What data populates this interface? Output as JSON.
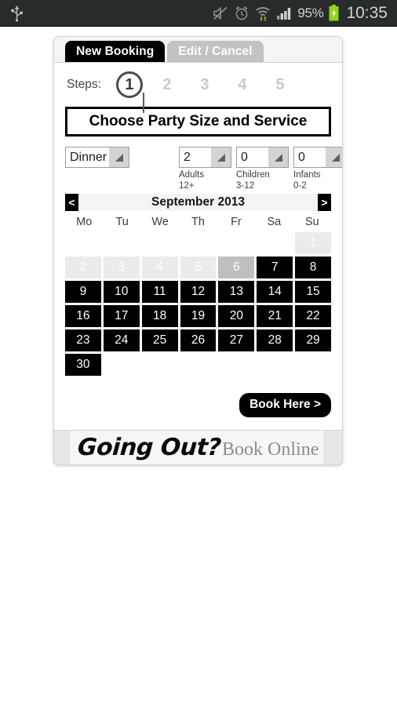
{
  "status_bar": {
    "usb_icon": "usb-icon",
    "icons": [
      "mute-icon",
      "alarm-icon",
      "wifi-icon",
      "signal-icon"
    ],
    "battery_percent": "95%",
    "battery_icon": "battery-charging-icon",
    "clock": "10:35",
    "background_color": "#272b2b",
    "text_color": "#cfd2d2",
    "battery_color": "#8fd315"
  },
  "tabs": [
    {
      "label": "New Booking",
      "active": true
    },
    {
      "label": "Edit / Cancel",
      "active": false
    }
  ],
  "steps": {
    "label": "Steps:",
    "items": [
      "1",
      "2",
      "3",
      "4",
      "5"
    ],
    "current": "1"
  },
  "section_title": "Choose Party Size and Service",
  "selects": [
    {
      "name": "service",
      "value": "Dinner",
      "caption_line1": "",
      "caption_line2": ""
    },
    {
      "name": "adults",
      "value": "2",
      "caption_line1": "Adults",
      "caption_line2": "12+"
    },
    {
      "name": "children",
      "value": "0",
      "caption_line1": "Children",
      "caption_line2": "3-12"
    },
    {
      "name": "infants",
      "value": "0",
      "caption_line1": "Infants",
      "caption_line2": "0-2"
    }
  ],
  "calendar": {
    "prev_label": "<",
    "next_label": ">",
    "month_label": "September 2013",
    "weekday_headers": [
      "Mo",
      "Tu",
      "We",
      "Th",
      "Fr",
      "Sa",
      "Su"
    ],
    "leading_blanks": 6,
    "days": [
      {
        "num": "1",
        "state": "past"
      },
      {
        "num": "2",
        "state": "past"
      },
      {
        "num": "3",
        "state": "past"
      },
      {
        "num": "4",
        "state": "past"
      },
      {
        "num": "5",
        "state": "past"
      },
      {
        "num": "6",
        "state": "today"
      },
      {
        "num": "7",
        "state": "avail"
      },
      {
        "num": "8",
        "state": "avail"
      },
      {
        "num": "9",
        "state": "avail"
      },
      {
        "num": "10",
        "state": "avail"
      },
      {
        "num": "11",
        "state": "avail"
      },
      {
        "num": "12",
        "state": "avail"
      },
      {
        "num": "13",
        "state": "avail"
      },
      {
        "num": "14",
        "state": "avail"
      },
      {
        "num": "15",
        "state": "avail"
      },
      {
        "num": "16",
        "state": "avail"
      },
      {
        "num": "17",
        "state": "avail"
      },
      {
        "num": "18",
        "state": "avail"
      },
      {
        "num": "19",
        "state": "avail"
      },
      {
        "num": "20",
        "state": "avail"
      },
      {
        "num": "21",
        "state": "avail"
      },
      {
        "num": "22",
        "state": "avail"
      },
      {
        "num": "23",
        "state": "avail"
      },
      {
        "num": "24",
        "state": "avail"
      },
      {
        "num": "25",
        "state": "avail"
      },
      {
        "num": "26",
        "state": "avail"
      },
      {
        "num": "27",
        "state": "avail"
      },
      {
        "num": "28",
        "state": "avail"
      },
      {
        "num": "29",
        "state": "avail"
      },
      {
        "num": "30",
        "state": "avail"
      }
    ]
  },
  "book_button": "Book Here >",
  "footer": {
    "logo_script": "Going Out?",
    "logo_sub": "Book Online"
  }
}
